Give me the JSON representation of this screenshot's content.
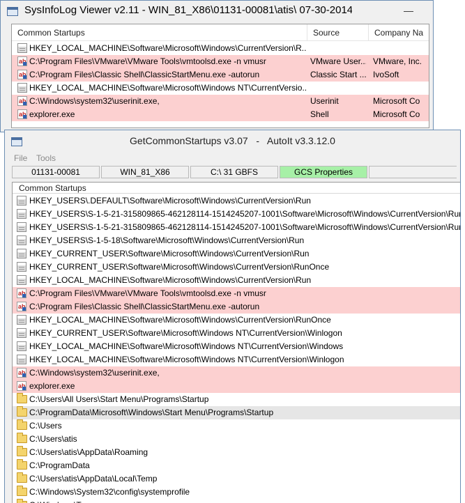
{
  "back_window": {
    "title": "SysInfoLog Viewer v2.11 - WIN_81_X86\\01131-00081\\atis\\ 07-30-2014 ...",
    "minimize_glyph": "—",
    "columns": [
      "Common Startups",
      "Source",
      "Company Na"
    ],
    "rows": [
      {
        "icon": "reg",
        "style": "plain",
        "path": "HKEY_LOCAL_MACHINE\\Software\\Microsoft\\Windows\\CurrentVersion\\R...",
        "source": "",
        "company": ""
      },
      {
        "icon": "ab",
        "style": "pink",
        "path": "C:\\Program Files\\VMware\\VMware Tools\\vmtoolsd.exe -n vmusr",
        "source": "VMware User...",
        "company": "VMware, Inc."
      },
      {
        "icon": "ab",
        "style": "pink",
        "path": "C:\\Program Files\\Classic Shell\\ClassicStartMenu.exe -autorun",
        "source": "Classic Start ...",
        "company": "IvoSoft"
      },
      {
        "icon": "reg",
        "style": "plain",
        "path": "HKEY_LOCAL_MACHINE\\Software\\Microsoft\\Windows NT\\CurrentVersio...",
        "source": "",
        "company": ""
      },
      {
        "icon": "ab",
        "style": "pink",
        "path": "C:\\Windows\\system32\\userinit.exe,",
        "source": "Userinit",
        "company": "Microsoft Co"
      },
      {
        "icon": "ab",
        "style": "pink",
        "path": "explorer.exe",
        "source": "Shell",
        "company": "Microsoft Co"
      }
    ]
  },
  "front_window": {
    "title": "GetCommonStartups v3.07   -   AutoIt v3.3.12.0",
    "menu": [
      "File",
      "Tools"
    ],
    "status_segments": [
      "01131-00081",
      "WIN_81_X86",
      "C:\\ 31 GBFS",
      "GCS Properties"
    ],
    "column_header": "Common Startups",
    "rows": [
      {
        "icon": "reg",
        "style": "plain",
        "text": "HKEY_USERS\\.DEFAULT\\Software\\Microsoft\\Windows\\CurrentVersion\\Run"
      },
      {
        "icon": "reg",
        "style": "plain",
        "text": "HKEY_USERS\\S-1-5-21-315809865-462128114-1514245207-1001\\Software\\Microsoft\\Windows\\CurrentVersion\\Run"
      },
      {
        "icon": "reg",
        "style": "plain",
        "text": "HKEY_USERS\\S-1-5-21-315809865-462128114-1514245207-1001\\Software\\Microsoft\\Windows\\CurrentVersion\\RunO"
      },
      {
        "icon": "reg",
        "style": "plain",
        "text": "HKEY_USERS\\S-1-5-18\\Software\\Microsoft\\Windows\\CurrentVersion\\Run"
      },
      {
        "icon": "reg",
        "style": "plain",
        "text": "HKEY_CURRENT_USER\\Software\\Microsoft\\Windows\\CurrentVersion\\Run"
      },
      {
        "icon": "reg",
        "style": "plain",
        "text": "HKEY_CURRENT_USER\\Software\\Microsoft\\Windows\\CurrentVersion\\RunOnce"
      },
      {
        "icon": "reg",
        "style": "plain",
        "text": "HKEY_LOCAL_MACHINE\\Software\\Microsoft\\Windows\\CurrentVersion\\Run"
      },
      {
        "icon": "ab",
        "style": "pink",
        "text": "C:\\Program Files\\VMware\\VMware Tools\\vmtoolsd.exe -n vmusr"
      },
      {
        "icon": "ab",
        "style": "pink",
        "text": "C:\\Program Files\\Classic Shell\\ClassicStartMenu.exe -autorun"
      },
      {
        "icon": "reg",
        "style": "plain",
        "text": "HKEY_LOCAL_MACHINE\\Software\\Microsoft\\Windows\\CurrentVersion\\RunOnce"
      },
      {
        "icon": "reg",
        "style": "plain",
        "text": "HKEY_CURRENT_USER\\Software\\Microsoft\\Windows NT\\CurrentVersion\\Winlogon"
      },
      {
        "icon": "reg",
        "style": "plain",
        "text": "HKEY_LOCAL_MACHINE\\Software\\Microsoft\\Windows NT\\CurrentVersion\\Windows"
      },
      {
        "icon": "reg",
        "style": "plain",
        "text": "HKEY_LOCAL_MACHINE\\Software\\Microsoft\\Windows NT\\CurrentVersion\\Winlogon"
      },
      {
        "icon": "ab",
        "style": "pink",
        "text": "C:\\Windows\\system32\\userinit.exe,"
      },
      {
        "icon": "ab",
        "style": "pink",
        "text": "explorer.exe"
      },
      {
        "icon": "folder",
        "style": "plain",
        "text": "C:\\Users\\All Users\\Start Menu\\Programs\\Startup"
      },
      {
        "icon": "folder",
        "style": "sel",
        "text": "C:\\ProgramData\\Microsoft\\Windows\\Start Menu\\Programs\\Startup"
      },
      {
        "icon": "folder",
        "style": "plain",
        "text": "C:\\Users"
      },
      {
        "icon": "folder",
        "style": "plain",
        "text": "C:\\Users\\atis"
      },
      {
        "icon": "folder",
        "style": "plain",
        "text": "C:\\Users\\atis\\AppData\\Roaming"
      },
      {
        "icon": "folder",
        "style": "plain",
        "text": "C:\\ProgramData"
      },
      {
        "icon": "folder",
        "style": "plain",
        "text": "C:\\Users\\atis\\AppData\\Local\\Temp"
      },
      {
        "icon": "folder",
        "style": "plain",
        "text": "C:\\Windows\\System32\\config\\systemprofile"
      },
      {
        "icon": "folder",
        "style": "plain",
        "text": "C:\\Windows\\Temp"
      }
    ]
  },
  "colors": {
    "pink_row": "#fcd0d0",
    "selected_row": "#e6e6e6",
    "green_segment": "#a7f0a7",
    "window_border": "#6d8fb4"
  }
}
